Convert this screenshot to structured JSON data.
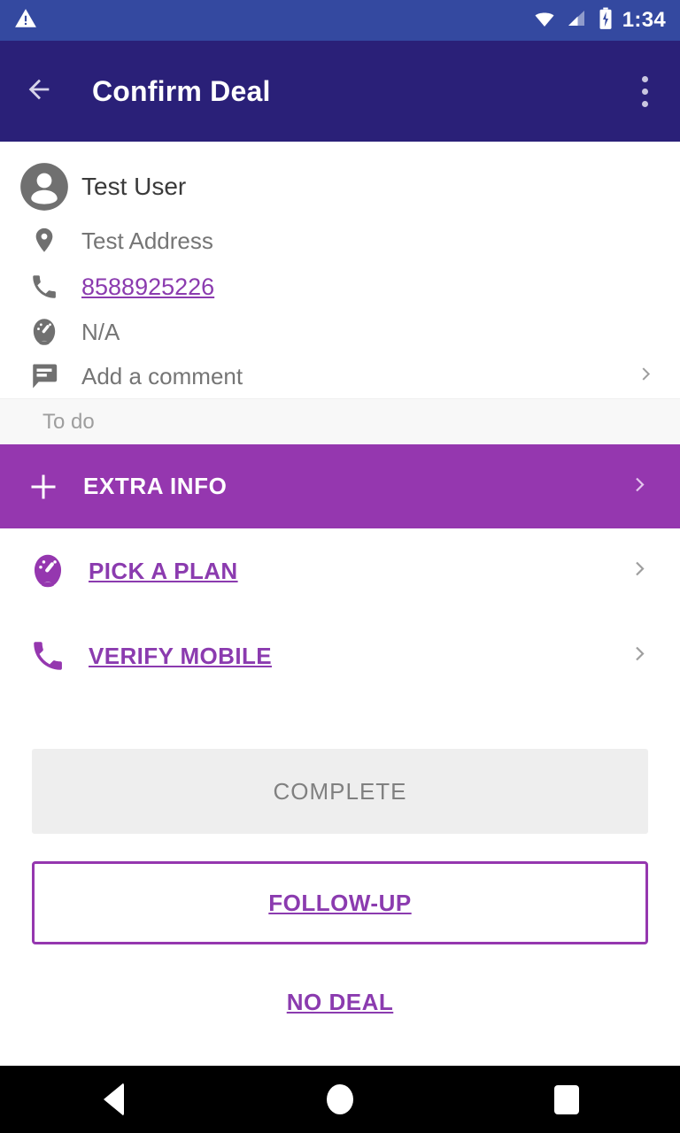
{
  "status_bar": {
    "warning_icon": "warning-triangle-icon",
    "wifi_icon": "wifi-icon",
    "signal_icon": "cell-signal-icon",
    "battery_icon": "battery-charging-icon",
    "time": "1:34",
    "background": "#3449a0"
  },
  "app_bar": {
    "back_icon": "arrow-back-icon",
    "title": "Confirm Deal",
    "overflow_icon": "more-vert-icon",
    "background": "#2a2078"
  },
  "contact": {
    "avatar_icon": "person-avatar-icon",
    "name": "Test User",
    "address_icon": "location-pin-icon",
    "address": "Test Address",
    "phone_icon": "phone-icon",
    "phone": "8588925226",
    "plan_icon": "speedometer-icon",
    "plan": "N/A",
    "comment_icon": "comment-bubble-icon",
    "comment": "Add a comment",
    "comment_chevron": "chevron-right-icon"
  },
  "section": {
    "todo_label": "To do"
  },
  "extra_info": {
    "plus_icon": "plus-icon",
    "label": "EXTRA INFO",
    "chevron": "chevron-right-icon",
    "background": "#9537af"
  },
  "tasks": [
    {
      "icon": "speedometer-icon",
      "label": "PICK A PLAN",
      "chevron": "chevron-right-icon"
    },
    {
      "icon": "phone-icon",
      "label": "VERIFY MOBILE",
      "chevron": "chevron-right-icon"
    }
  ],
  "buttons": {
    "complete_label": "COMPLETE",
    "complete_state": "disabled",
    "follow_up_label": "FOLLOW-UP",
    "no_deal_label": "NO DEAL"
  },
  "nav_bar": {
    "back_icon": "nav-back-icon",
    "home_icon": "nav-home-icon",
    "recents_icon": "nav-recents-icon"
  },
  "colors": {
    "accent_purple": "#9537af",
    "link_purple": "#8b3baf",
    "app_bar": "#2a2078",
    "status_bar": "#3449a0"
  }
}
